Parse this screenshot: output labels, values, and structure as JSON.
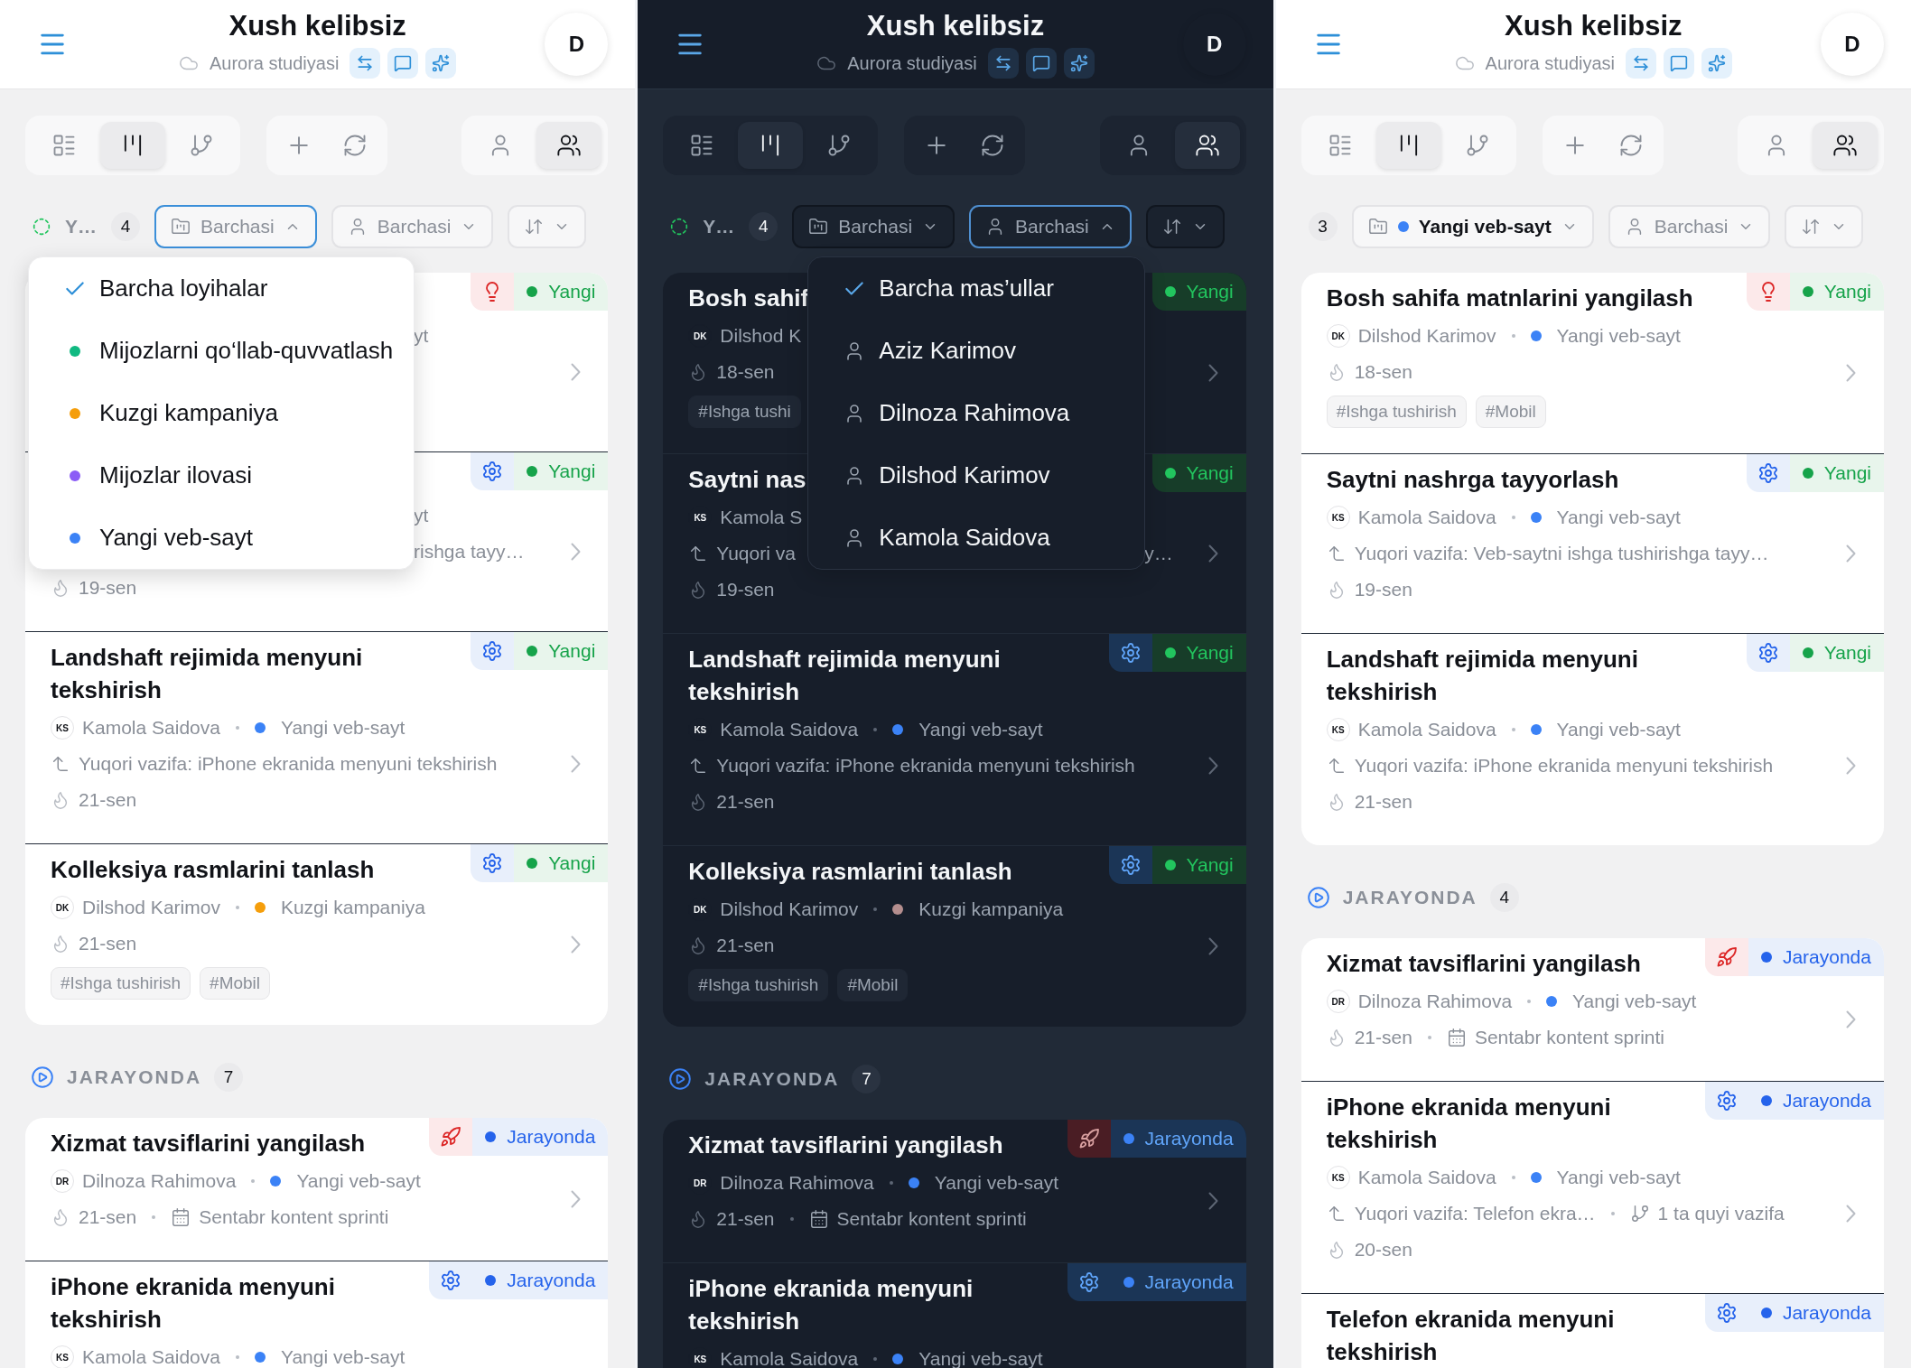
{
  "panels": [
    {
      "kind": "light",
      "header": {
        "title": "Xush kelibsiz",
        "workspace": "Aurora studiyasi",
        "avatar": "D"
      },
      "toolbar": {
        "views": [
          {
            "kind": "list",
            "selected": false
          },
          {
            "kind": "board",
            "selected": true
          },
          {
            "kind": "tree",
            "selected": false
          }
        ],
        "scopes": [
          {
            "kind": "mine",
            "selected": false
          },
          {
            "kind": "team",
            "selected": true
          }
        ]
      },
      "filters": {
        "section": {
          "label": "Y…",
          "count": "4"
        },
        "project": {
          "label": "Barchasi",
          "open": true
        },
        "assignee": {
          "label": "Barchasi",
          "open": false
        }
      },
      "menu": {
        "kind": "project",
        "items": [
          {
            "label": "Barcha loyihalar",
            "selected": true
          },
          {
            "label": "Mijozlarni qo‘llab-quvvatlash",
            "color": "#10b981",
            "selected": false
          },
          {
            "label": "Kuzgi kampaniya",
            "color": "#f59e0b",
            "selected": false
          },
          {
            "label": "Mijozlar ilovasi",
            "color": "#8b5cf6",
            "selected": false
          },
          {
            "label": "Yangi veb-sayt",
            "color": "#3b82f6",
            "selected": false
          }
        ]
      },
      "sections": [
        {
          "cards": [
            {
              "kind": "idea",
              "badge": {
                "status": "Yangi",
                "kind": "new"
              },
              "lines": [
                {
                  "kind": "covered",
                  "tail": "yt"
                },
                {
                  "kind": "covered"
                },
                {
                  "kind": "covered"
                }
              ],
              "chevron": true
            },
            {
              "kind": "settings",
              "badge": {
                "status": "Yangi",
                "kind": "new"
              },
              "lines": [
                {
                  "kind": "covered",
                  "tail": "yt"
                },
                {
                  "kind": "covered",
                  "tail": "rishga tayy…"
                },
                {
                  "kind": "due",
                  "text": "19-sen"
                }
              ],
              "chevron": true
            },
            {
              "kind": "settings",
              "title": "Landshaft rejimida menyuni tekshirish",
              "badge": {
                "status": "Yangi",
                "kind": "new"
              },
              "lines": [
                {
                  "kind": "people",
                  "initials": "KS",
                  "name": "Kamola Saidova",
                  "project": "Yangi veb-sayt",
                  "color": "#3b82f6"
                },
                {
                  "kind": "parent",
                  "text": "Yuqori vazifa: iPhone ekranida menyuni tekshirish"
                },
                {
                  "kind": "due",
                  "text": "21-sen"
                }
              ],
              "chevron": true
            },
            {
              "kind": "settings",
              "title": "Kolleksiya rasmlarini tanlash",
              "badge": {
                "status": "Yangi",
                "kind": "new"
              },
              "lines": [
                {
                  "kind": "people",
                  "initials": "DK",
                  "name": "Dilshod Karimov",
                  "project": "Kuzgi kampaniya",
                  "color": "#f59e0b"
                },
                {
                  "kind": "due",
                  "text": "21-sen"
                }
              ],
              "tags": [
                "#Ishga tushirish",
                "#Mobil"
              ],
              "chevron": true
            }
          ]
        },
        {
          "title": "JARAYONDA",
          "count": "7",
          "cards": [
            {
              "kind": "launch",
              "title": "Xizmat tavsiflarini yangilash",
              "badge": {
                "status": "Jarayonda",
                "kind": "progress"
              },
              "lines": [
                {
                  "kind": "people",
                  "initials": "DR",
                  "name": "Dilnoza Rahimova",
                  "project": "Yangi veb-sayt",
                  "color": "#3b82f6"
                },
                {
                  "kind": "due",
                  "text": "21-sen",
                  "sprint": "Sentabr kontent sprinti"
                }
              ],
              "chevron": true
            },
            {
              "kind": "settings",
              "title": "iPhone ekranida menyuni tekshirish",
              "badge": {
                "status": "Jarayonda",
                "kind": "progress"
              },
              "lines": [
                {
                  "kind": "people",
                  "initials": "KS",
                  "name": "Kamola Saidova",
                  "project": "Yangi veb-sayt",
                  "color": "#3b82f6"
                }
              ]
            }
          ]
        }
      ]
    },
    {
      "kind": "dark",
      "header": {
        "title": "Xush kelibsiz",
        "workspace": "Aurora studiyasi",
        "avatar": "D"
      },
      "toolbar": {
        "views": [
          {
            "kind": "list",
            "selected": false
          },
          {
            "kind": "board",
            "selected": true
          },
          {
            "kind": "tree",
            "selected": false
          }
        ],
        "scopes": [
          {
            "kind": "mine",
            "selected": false
          },
          {
            "kind": "team",
            "selected": true
          }
        ]
      },
      "filters": {
        "section": {
          "label": "Y…",
          "count": "4"
        },
        "project": {
          "label": "Barchasi",
          "open": false
        },
        "assignee": {
          "label": "Barchasi",
          "open": true
        }
      },
      "menu": {
        "kind": "people",
        "items": [
          {
            "label": "Barcha mas’ullar",
            "selected": true
          },
          {
            "label": "Aziz Karimov",
            "selected": false
          },
          {
            "label": "Dilnoza Rahimova",
            "selected": false
          },
          {
            "label": "Dilshod Karimov",
            "selected": false
          },
          {
            "label": "Kamola Saidova",
            "selected": false
          }
        ]
      },
      "sections": [
        {
          "cards": [
            {
              "title": "Bosh sahif",
              "badge": {
                "status": "Yangi",
                "kind": "new"
              },
              "lines": [
                {
                  "kind": "people",
                  "initials": "DK",
                  "name": "Dilshod K"
                },
                {
                  "kind": "due",
                  "text": "18-sen"
                }
              ],
              "tags": [
                "#Ishga tushi"
              ],
              "chevron": true
            },
            {
              "title": "Saytni nas",
              "badge": {
                "status": "Yangi",
                "kind": "new"
              },
              "lines": [
                {
                  "kind": "people",
                  "initials": "KS",
                  "name": "Kamola S"
                },
                {
                  "kind": "parent",
                  "text": "Yuqori va",
                  "tail": "y…"
                },
                {
                  "kind": "due",
                  "text": "19-sen"
                }
              ],
              "chevron": true
            },
            {
              "kind": "settings",
              "title": "Landshaft rejimida menyuni tekshirish",
              "badge": {
                "status": "Yangi",
                "kind": "new"
              },
              "lines": [
                {
                  "kind": "people",
                  "initials": "KS",
                  "name": "Kamola Saidova",
                  "project": "Yangi veb-sayt",
                  "color": "#3b82f6"
                },
                {
                  "kind": "parent",
                  "text": "Yuqori vazifa: iPhone ekranida menyuni tekshirish"
                },
                {
                  "kind": "due",
                  "text": "21-sen"
                }
              ],
              "chevron": true
            },
            {
              "kind": "settings",
              "title": "Kolleksiya rasmlarini tanlash",
              "badge": {
                "status": "Yangi",
                "kind": "new"
              },
              "lines": [
                {
                  "kind": "people",
                  "initials": "DK",
                  "name": "Dilshod Karimov",
                  "project": "Kuzgi kampaniya",
                  "color": "#b48e8e"
                },
                {
                  "kind": "due",
                  "text": "21-sen"
                }
              ],
              "tags": [
                "#Ishga tushirish",
                "#Mobil"
              ],
              "chevron": true
            }
          ]
        },
        {
          "title": "JARAYONDA",
          "count": "7",
          "cards": [
            {
              "kind": "launch",
              "title": "Xizmat tavsiflarini yangilash",
              "badge": {
                "status": "Jarayonda",
                "kind": "progress"
              },
              "lines": [
                {
                  "kind": "people",
                  "initials": "DR",
                  "name": "Dilnoza Rahimova",
                  "project": "Yangi veb-sayt",
                  "color": "#3b82f6"
                },
                {
                  "kind": "due",
                  "text": "21-sen",
                  "sprint": "Sentabr kontent sprinti"
                }
              ],
              "chevron": true
            },
            {
              "kind": "settings",
              "title": "iPhone ekranida menyuni tekshirish",
              "badge": {
                "status": "Jarayonda",
                "kind": "progress"
              },
              "lines": [
                {
                  "kind": "people",
                  "initials": "KS",
                  "name": "Kamola Saidova",
                  "project": "Yangi veb-sayt",
                  "color": "#3b82f6"
                }
              ]
            }
          ]
        }
      ]
    },
    {
      "kind": "light",
      "header": {
        "title": "Xush kelibsiz",
        "workspace": "Aurora studiyasi",
        "avatar": "D"
      },
      "toolbar": {
        "views": [
          {
            "kind": "list",
            "selected": false
          },
          {
            "kind": "board",
            "selected": true
          },
          {
            "kind": "tree",
            "selected": false
          }
        ],
        "scopes": [
          {
            "kind": "mine",
            "selected": false
          },
          {
            "kind": "team",
            "selected": true
          }
        ]
      },
      "filters": {
        "section": {
          "count": "3"
        },
        "project": {
          "label": "Yangi veb-sayt",
          "color": "#3b82f6",
          "open": false
        },
        "assignee": {
          "label": "Barchasi",
          "open": false
        }
      },
      "sections": [
        {
          "cards": [
            {
              "kind": "idea",
              "title": "Bosh sahifa matnlarini yangilash",
              "badge": {
                "status": "Yangi",
                "kind": "new"
              },
              "lines": [
                {
                  "kind": "people",
                  "initials": "DK",
                  "name": "Dilshod Karimov",
                  "project": "Yangi veb-sayt",
                  "color": "#3b82f6"
                },
                {
                  "kind": "due",
                  "text": "18-sen"
                }
              ],
              "tags": [
                "#Ishga tushirish",
                "#Mobil"
              ],
              "chevron": true
            },
            {
              "kind": "settings",
              "title": "Saytni nashrga tayyorlash",
              "badge": {
                "status": "Yangi",
                "kind": "new"
              },
              "lines": [
                {
                  "kind": "people",
                  "initials": "KS",
                  "name": "Kamola Saidova",
                  "project": "Yangi veb-sayt",
                  "color": "#3b82f6"
                },
                {
                  "kind": "parent",
                  "text": "Yuqori vazifa: Veb-saytni ishga tushirishga tayy…"
                },
                {
                  "kind": "due",
                  "text": "19-sen"
                }
              ],
              "chevron": true
            },
            {
              "kind": "settings",
              "title": "Landshaft rejimida menyuni tekshirish",
              "badge": {
                "status": "Yangi",
                "kind": "new"
              },
              "lines": [
                {
                  "kind": "people",
                  "initials": "KS",
                  "name": "Kamola Saidova",
                  "project": "Yangi veb-sayt",
                  "color": "#3b82f6"
                },
                {
                  "kind": "parent",
                  "text": "Yuqori vazifa: iPhone ekranida menyuni tekshirish"
                },
                {
                  "kind": "due",
                  "text": "21-sen"
                }
              ],
              "chevron": true
            }
          ]
        },
        {
          "title": "JARAYONDA",
          "count": "4",
          "cards": [
            {
              "kind": "launch",
              "title": "Xizmat tavsiflarini yangilash",
              "badge": {
                "status": "Jarayonda",
                "kind": "progress"
              },
              "lines": [
                {
                  "kind": "people",
                  "initials": "DR",
                  "name": "Dilnoza Rahimova",
                  "project": "Yangi veb-sayt",
                  "color": "#3b82f6"
                },
                {
                  "kind": "due",
                  "text": "21-sen",
                  "sprint": "Sentabr kontent sprinti"
                }
              ],
              "chevron": true
            },
            {
              "kind": "settings",
              "title": "iPhone ekranida menyuni tekshirish",
              "badge": {
                "status": "Jarayonda",
                "kind": "progress"
              },
              "lines": [
                {
                  "kind": "people",
                  "initials": "KS",
                  "name": "Kamola Saidova",
                  "project": "Yangi veb-sayt",
                  "color": "#3b82f6"
                },
                {
                  "kind": "parent",
                  "text": "Yuqori vazifa: Telefon ekra…",
                  "subtasks": "1 ta quyi vazifa"
                },
                {
                  "kind": "due",
                  "text": "20-sen"
                }
              ],
              "chevron": true
            },
            {
              "kind": "settings",
              "title": "Telefon ekranida menyuni tekshirish",
              "badge": {
                "status": "Jarayonda",
                "kind": "progress"
              }
            }
          ]
        }
      ]
    }
  ]
}
